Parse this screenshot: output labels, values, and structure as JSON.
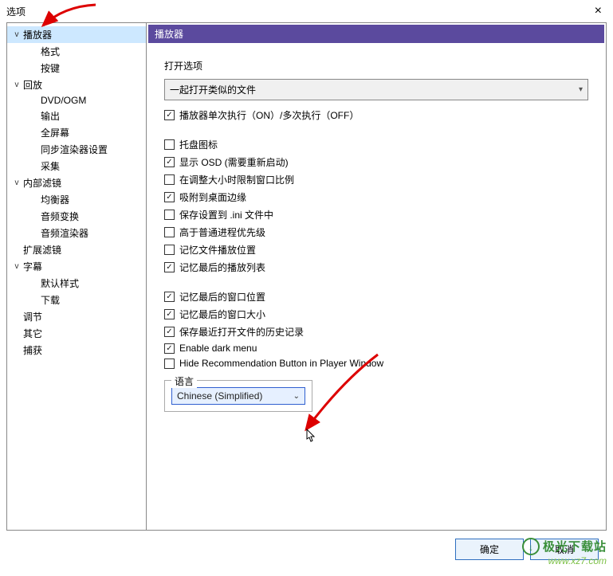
{
  "window": {
    "title": "选项",
    "close": "×"
  },
  "tree": [
    {
      "label": "播放器",
      "depth": 0,
      "expand": "v",
      "selected": true
    },
    {
      "label": "格式",
      "depth": 1
    },
    {
      "label": "按键",
      "depth": 1
    },
    {
      "label": "回放",
      "depth": 0,
      "expand": "v"
    },
    {
      "label": "DVD/OGM",
      "depth": 1
    },
    {
      "label": "输出",
      "depth": 1
    },
    {
      "label": "全屏幕",
      "depth": 1
    },
    {
      "label": "同步渲染器设置",
      "depth": 1
    },
    {
      "label": "采集",
      "depth": 1
    },
    {
      "label": "内部滤镜",
      "depth": 0,
      "expand": "v"
    },
    {
      "label": "均衡器",
      "depth": 1
    },
    {
      "label": "音频变换",
      "depth": 1
    },
    {
      "label": "音频渲染器",
      "depth": 1
    },
    {
      "label": "扩展滤镜",
      "depth": 0
    },
    {
      "label": "字幕",
      "depth": 0,
      "expand": "v"
    },
    {
      "label": "默认样式",
      "depth": 1
    },
    {
      "label": "下载",
      "depth": 1
    },
    {
      "label": "调节",
      "depth": 0
    },
    {
      "label": "其它",
      "depth": 0
    },
    {
      "label": "捕获",
      "depth": 0
    }
  ],
  "section_header": "播放器",
  "open_options": {
    "label": "打开选项",
    "value": "一起打开类似的文件"
  },
  "checks": [
    {
      "label": "播放器单次执行（ON）/多次执行（OFF）",
      "checked": true,
      "gap": false
    },
    {
      "label": "托盘图标",
      "checked": false,
      "gap": true
    },
    {
      "label": "显示 OSD (需要重新启动)",
      "checked": true
    },
    {
      "label": "在调整大小时限制窗口比例",
      "checked": false
    },
    {
      "label": "吸附到桌面边缘",
      "checked": true
    },
    {
      "label": "保存设置到 .ini 文件中",
      "checked": false
    },
    {
      "label": "高于普通进程优先级",
      "checked": false
    },
    {
      "label": "记忆文件播放位置",
      "checked": false
    },
    {
      "label": "记忆最后的播放列表",
      "checked": true
    },
    {
      "label": "记忆最后的窗口位置",
      "checked": true,
      "gap": true
    },
    {
      "label": "记忆最后的窗口大小",
      "checked": true
    },
    {
      "label": "保存最近打开文件的历史记录",
      "checked": true
    },
    {
      "label": "Enable dark menu",
      "checked": true
    },
    {
      "label": "Hide Recommendation Button in Player Window",
      "checked": false
    }
  ],
  "language": {
    "legend": "语言",
    "value": "Chinese (Simplified)"
  },
  "buttons": {
    "ok": "确定",
    "cancel": "取消"
  },
  "watermark": {
    "line1": "极光下载站",
    "line2": "www.xz7.com",
    "glyph": "↓"
  }
}
